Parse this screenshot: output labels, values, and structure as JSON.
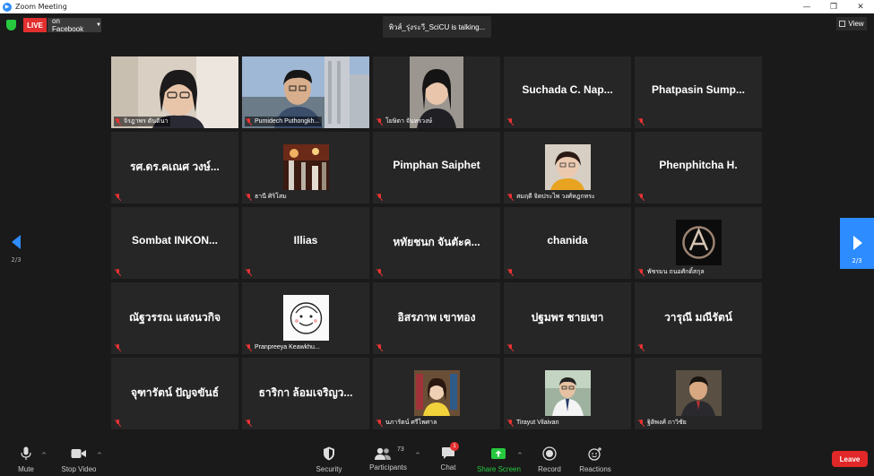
{
  "window": {
    "title": "Zoom Meeting"
  },
  "topbar": {
    "live_label": "LIVE",
    "live_destination": "on Facebook",
    "talking": "พิวส์_รุ่งระวี_SciCU is talking...",
    "view_label": "View"
  },
  "pager": {
    "left": "2/3",
    "right": "2/3"
  },
  "tiles": [
    {
      "name": "จิรฎาพร ตันตินา",
      "center": "",
      "video": true
    },
    {
      "name": "Pumidech Puthongkh...",
      "center": "",
      "video": true
    },
    {
      "name": "โยษิตา จันทรวงษ์",
      "center": "",
      "video": true
    },
    {
      "name": "",
      "center": "Suchada C. Nap...",
      "video": false
    },
    {
      "name": "",
      "center": "Phatpasin Sump...",
      "video": false
    },
    {
      "name": "",
      "center": "รศ.ดร.คเณศ วงษ์...",
      "video": false
    },
    {
      "name": "ธานี ศิริโสม",
      "center": "",
      "video": true
    },
    {
      "name": "",
      "center": "Pimphan Saiphet",
      "video": false
    },
    {
      "name": "สมฤดี จิตประไพ วงศ์หฎกทระ",
      "center": "",
      "video": true
    },
    {
      "name": "",
      "center": "Phenphitcha H.",
      "video": false
    },
    {
      "name": "",
      "center": "Sombat INKON...",
      "video": false
    },
    {
      "name": "",
      "center": "Illias",
      "video": false
    },
    {
      "name": "",
      "center": "หทัยชนก จันตัะค...",
      "video": false
    },
    {
      "name": "",
      "center": "chanida",
      "video": false
    },
    {
      "name": "พัชรมน ถนอศักดิ์สกุล",
      "center": "",
      "video": true
    },
    {
      "name": "",
      "center": "ณัฐวรรณ แสงนวกิจ",
      "video": false
    },
    {
      "name": "Pranpreeya Keawkhu...",
      "center": "",
      "video": true
    },
    {
      "name": "",
      "center": "อิสรภาพ เขาทอง",
      "video": false
    },
    {
      "name": "",
      "center": "ปฐมพร ชายเขา",
      "video": false
    },
    {
      "name": "",
      "center": "วารุณี มณีรัตน์",
      "video": false
    },
    {
      "name": "",
      "center": "จุฑารัตน์ ปัญจขันธ์",
      "video": false
    },
    {
      "name": "",
      "center": "ธาริกา ล้อมเจริญว...",
      "video": false
    },
    {
      "name": "นภารัตน์ ศรีไพศาล",
      "center": "",
      "video": true
    },
    {
      "name": "Tirayut Vilaivan",
      "center": "",
      "video": true
    },
    {
      "name": "ฐิติพงศ์ ถาวิชัย",
      "center": "",
      "video": true
    }
  ],
  "toolbar": {
    "mute": "Mute",
    "stop_video": "Stop Video",
    "security": "Security",
    "participants": "Participants",
    "participants_count": "73",
    "chat": "Chat",
    "chat_badge": "1",
    "share_screen": "Share Screen",
    "record": "Record",
    "reactions": "Reactions",
    "leave": "Leave"
  },
  "colors": {
    "accent": "#2d8cff",
    "live": "#e22f2f",
    "share": "#27c93f",
    "leave": "#e02828"
  }
}
